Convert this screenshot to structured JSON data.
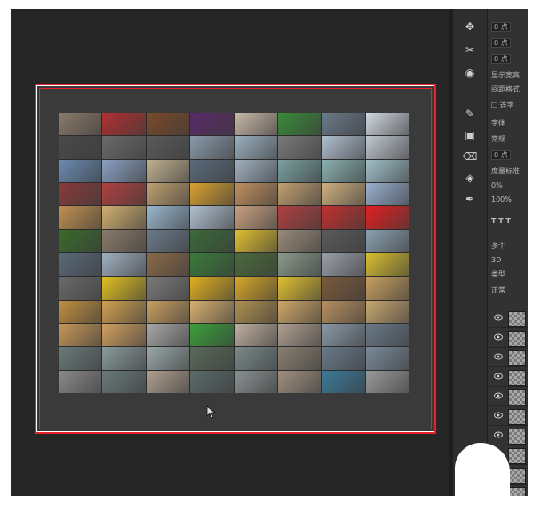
{
  "window": {
    "title": ""
  },
  "toolbar_icons": [
    "move-icon",
    "crop-icon",
    "heal-icon",
    "brush-icon",
    "stamp-icon",
    "eraser-icon",
    "paint-bucket-icon",
    "pen-icon"
  ],
  "properties_panel": {
    "field1": "0 点",
    "field2": "0 点",
    "field3": "0 点",
    "label_show": "显示宽高",
    "label_interval": "间距格式",
    "checkbox": "连字",
    "font_label": "字体",
    "font_style": "常规",
    "size": "0 点",
    "measure": "度量标准",
    "tracking": "0%",
    "scale": "100%",
    "text_options": "T T T",
    "multi": "多个",
    "threed": "3D",
    "type_label": "类型",
    "normal": "正常"
  },
  "layers": {
    "count": 10
  },
  "colors": {
    "background": "#262626",
    "artboard": "#393939",
    "selection": "#e8202a"
  },
  "contact_sheet": {
    "columns": 8,
    "rows": 12,
    "tiles": [
      [
        "#8a7a6a",
        "#b03030",
        "#7a4a2a",
        "#5a2a6a",
        "#c8b8a8",
        "#3a8a3a",
        "#6a7a8a",
        "#d0d8e0"
      ],
      [
        "#4a4a4a",
        "#6a6a6a",
        "#5a5a5a",
        "#8a9aaa",
        "#9ab0c0",
        "#7a7a7a",
        "#b0c0d0",
        "#c0c8d0"
      ],
      [
        "#6a8ab0",
        "#8aa0c0",
        "#c0b090",
        "#5a6a7a",
        "#a0b0c0",
        "#7aa0a0",
        "#8ab0b0",
        "#a0c0c8"
      ],
      [
        "#8a3a3a",
        "#b04040",
        "#c0a070",
        "#d8a030",
        "#c09060",
        "#c0a070",
        "#d0b080",
        "#9ab0d0"
      ],
      [
        "#c09050",
        "#d0b070",
        "#9ab8d0",
        "#b0c0d0",
        "#c8a080",
        "#b04040",
        "#c03030",
        "#e02020"
      ],
      [
        "#3a6a2a",
        "#8a7a6a",
        "#6a7a8a",
        "#3a6a3a",
        "#e0c030",
        "#9a8a7a",
        "#5a5a5a",
        "#8aa0b0"
      ],
      [
        "#5a6a7a",
        "#a0b0c0",
        "#8a6a4a",
        "#3a7a3a",
        "#4a6a3a",
        "#8a9a8a",
        "#9aa0a8",
        "#d8c030"
      ],
      [
        "#6a6a6a",
        "#e0c020",
        "#7a7a7a",
        "#e0b020",
        "#d8a828",
        "#e0c030",
        "#7a5a3a",
        "#c8a060"
      ],
      [
        "#c09040",
        "#d0a050",
        "#c8a060",
        "#d8b070",
        "#b09050",
        "#d0a868",
        "#b89060",
        "#c8a870"
      ],
      [
        "#c89858",
        "#d0a060",
        "#a8a8a8",
        "#3aa03a",
        "#c0b0a0",
        "#b0a090",
        "#8a9aa8",
        "#6a7a8a"
      ],
      [
        "#6a7a7a",
        "#8a9a9a",
        "#9aa8a8",
        "#5a6a5a",
        "#7a8a8a",
        "#8a8070",
        "#6a7a8a",
        "#7a8a9a"
      ],
      [
        "#8a8a8a",
        "#6a7a7a",
        "#b0a090",
        "#5a6a6a",
        "#8a9090",
        "#a09080",
        "#3a7a9a",
        "#9a9a9a"
      ]
    ]
  }
}
